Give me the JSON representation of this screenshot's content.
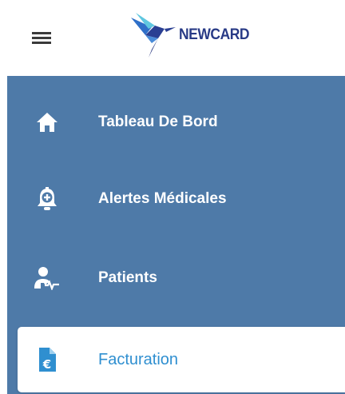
{
  "header": {
    "brand_name": "NEWCARD",
    "menu_icon": "hamburger-menu-icon",
    "logo_icon": "hummingbird-logo-icon"
  },
  "sidebar": {
    "items": [
      {
        "label": "Tableau De Bord",
        "icon": "home-icon",
        "active": false
      },
      {
        "label": "Alertes Médicales",
        "icon": "medical-alert-bell-icon",
        "active": false
      },
      {
        "label": "Patients",
        "icon": "patient-heartbeat-icon",
        "active": false
      },
      {
        "label": "Facturation",
        "icon": "invoice-euro-icon",
        "active": true
      }
    ]
  },
  "colors": {
    "sidebar_bg": "#4e7aa8",
    "active_text": "#2f8fd0",
    "brand_text": "#283a86",
    "inactive_text": "#ffffff"
  }
}
